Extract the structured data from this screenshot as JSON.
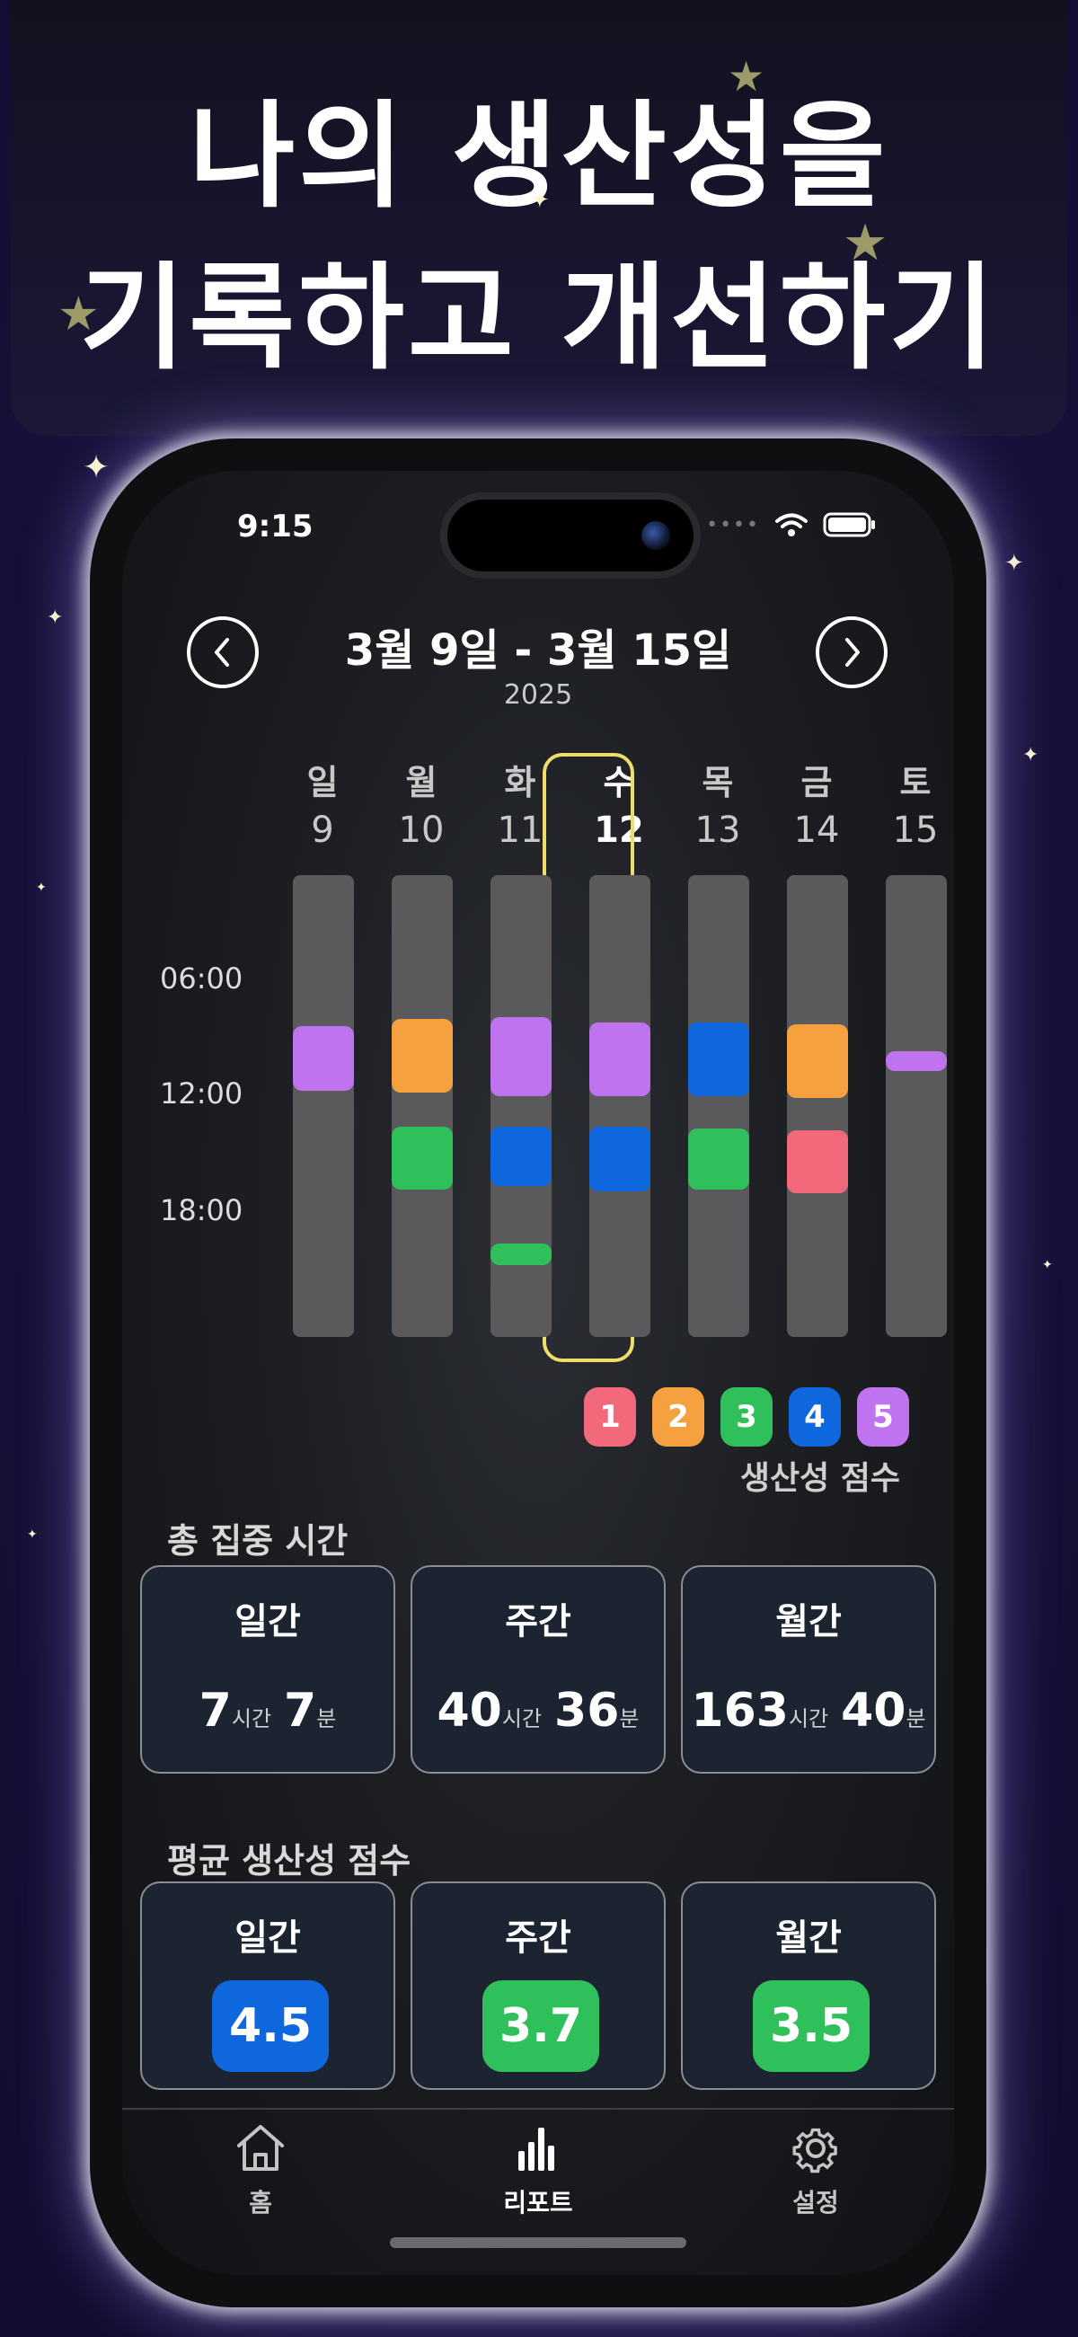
{
  "headline": {
    "line1": "나의 생산성을",
    "line2": "기록하고 개선하기"
  },
  "status_bar": {
    "time": "9:15"
  },
  "week": {
    "title": "3월 9일 - 3월 15일",
    "year": "2025"
  },
  "days": [
    {
      "name": "일",
      "date": "9"
    },
    {
      "name": "월",
      "date": "10"
    },
    {
      "name": "화",
      "date": "11"
    },
    {
      "name": "수",
      "date": "12",
      "selected": true
    },
    {
      "name": "목",
      "date": "13"
    },
    {
      "name": "금",
      "date": "14"
    },
    {
      "name": "토",
      "date": "15"
    }
  ],
  "time_labels": [
    "06:00",
    "12:00",
    "18:00"
  ],
  "score_colors": {
    "1": "#f2697b",
    "2": "#f5a13f",
    "3": "#2fc05b",
    "4": "#0f67de",
    "5": "#bf73ef"
  },
  "legend": {
    "items": [
      "1",
      "2",
      "3",
      "4",
      "5"
    ],
    "caption": "생산성 점수"
  },
  "focus_time": {
    "title": "총 집중 시간",
    "cards": [
      {
        "label": "일간",
        "hours": "7",
        "hour_unit": "시간",
        "minutes": "7",
        "minute_unit": "분"
      },
      {
        "label": "주간",
        "hours": "40",
        "hour_unit": "시간",
        "minutes": "36",
        "minute_unit": "분"
      },
      {
        "label": "월간",
        "hours": "163",
        "hour_unit": "시간",
        "minutes": "40",
        "minute_unit": "분"
      }
    ]
  },
  "avg_score": {
    "title": "평균 생산성 점수",
    "cards": [
      {
        "label": "일간",
        "value": "4.5",
        "color": "#0f67de"
      },
      {
        "label": "주간",
        "value": "3.7",
        "color": "#2fc05b"
      },
      {
        "label": "월간",
        "value": "3.5",
        "color": "#2fc05b"
      }
    ]
  },
  "tabs": [
    {
      "label": "홈",
      "icon": "home-icon"
    },
    {
      "label": "리포트",
      "icon": "bar-chart-icon",
      "active": true
    },
    {
      "label": "설정",
      "icon": "gear-icon"
    }
  ]
}
